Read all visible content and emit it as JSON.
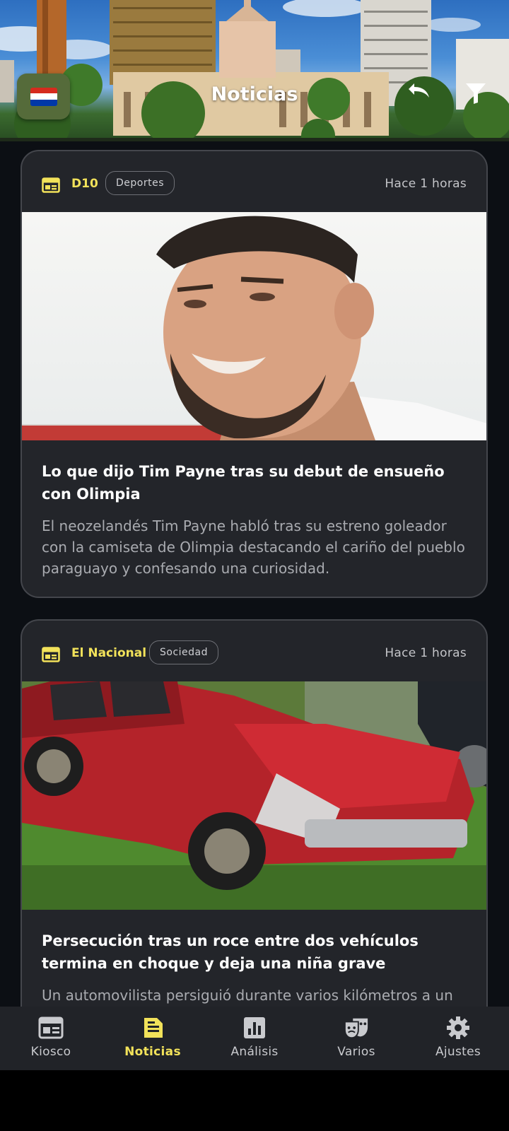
{
  "header": {
    "title": "Noticias",
    "flag_colors": [
      "#d52b1e",
      "#ffffff",
      "#0038a8"
    ],
    "undo_icon": "undo-icon",
    "filter_icon": "filter-icon"
  },
  "accent_color": "#f2e25a",
  "articles": [
    {
      "source": "D10",
      "category": "Deportes",
      "time": "Hace 1 horas",
      "title": "Lo que dijo Tim Payne tras su debut de ensueño con Olimpia",
      "description": "El neozelandés Tim Payne habló tras su estreno goleador con la camiseta de Olimpia destacando el cariño del pueblo paraguayo y confesando una curiosidad."
    },
    {
      "source": "El Nacional",
      "category": "Sociedad",
      "time": "Hace 1 horas",
      "title": "Persecución tras un roce entre dos vehículos termina en choque y deja una niña grave",
      "description": "Un automovilista persiguió durante varios kilómetros a un"
    }
  ],
  "nav": {
    "items": [
      {
        "label": "Kiosco",
        "icon": "newspaper-icon"
      },
      {
        "label": "Noticias",
        "icon": "article-icon",
        "active": true
      },
      {
        "label": "Análisis",
        "icon": "bar-chart-icon"
      },
      {
        "label": "Varios",
        "icon": "theater-masks-icon"
      },
      {
        "label": "Ajustes",
        "icon": "gear-icon"
      }
    ]
  }
}
